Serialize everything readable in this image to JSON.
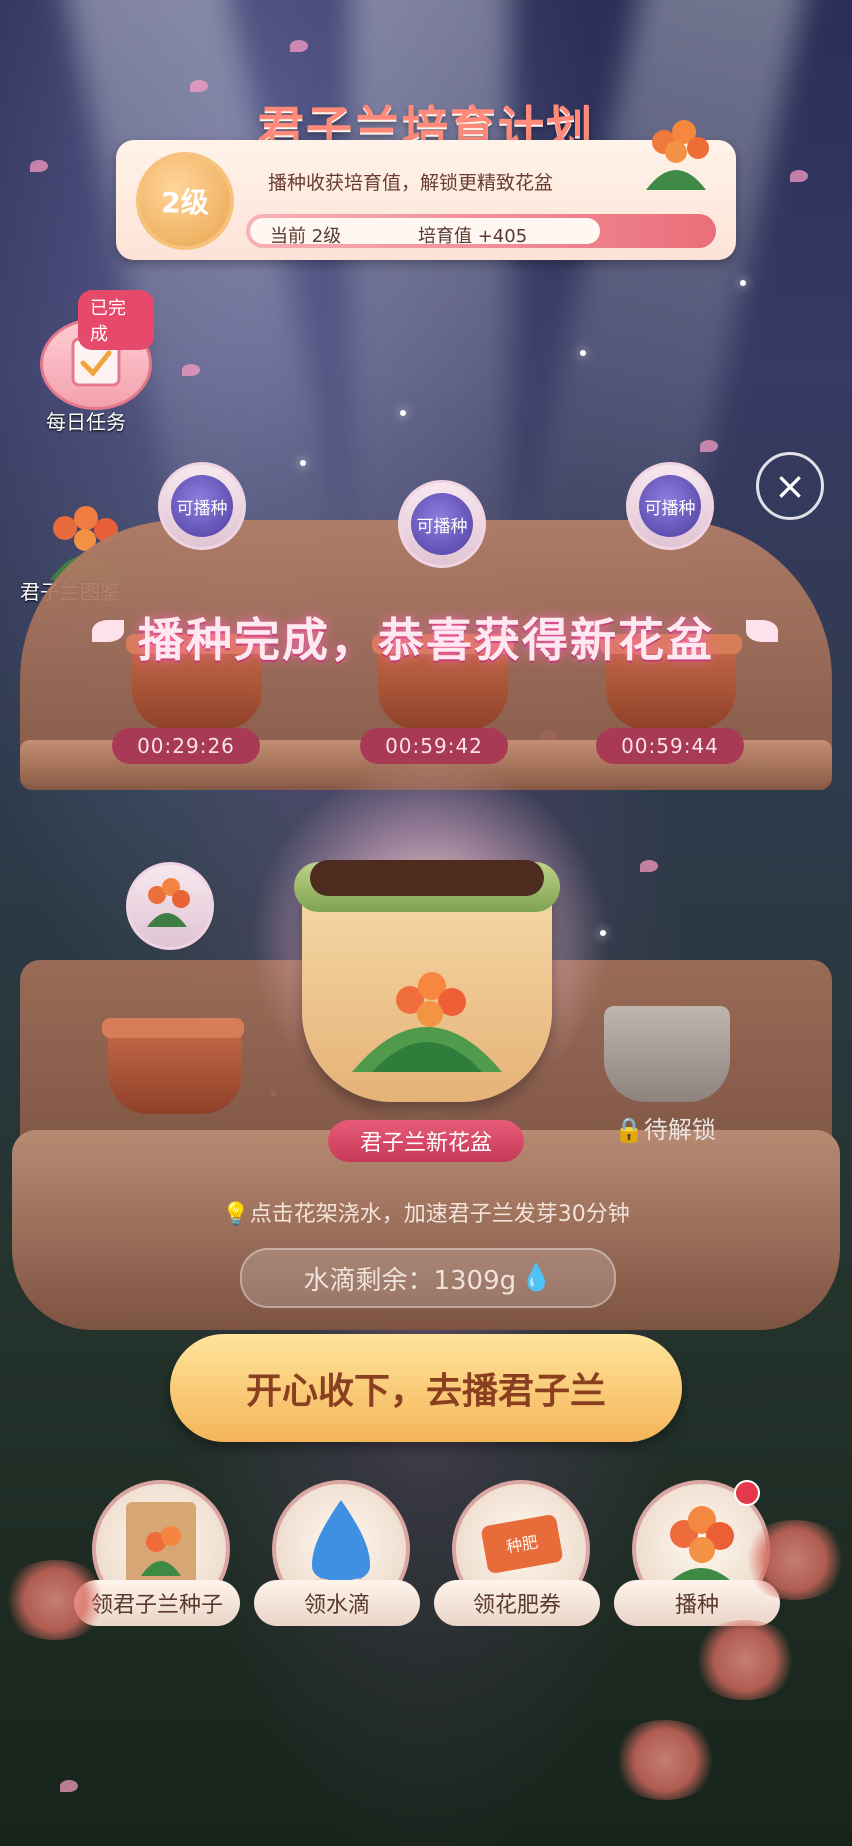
{
  "header": {
    "title": "君子兰培育计划",
    "level": "2级",
    "description": "播种收获培育值，解锁更精致花盆",
    "progress_current": "当前 2级",
    "progress_value": "培育值 +405"
  },
  "side": {
    "daily_badge": "已完成",
    "daily_label": "每日任务",
    "guide_label": "君子兰图鉴"
  },
  "slots": [
    {
      "bubble": "可播种",
      "timer": "00:29:26"
    },
    {
      "bubble": "可播种",
      "timer": "00:59:42"
    },
    {
      "bubble": "可播种",
      "timer": "00:59:44"
    }
  ],
  "banner": "播种完成，恭喜获得新花盆",
  "new_pot_label": "君子兰新花盆",
  "locked_label": "待解锁",
  "hint": "点击花架浇水，加速君子兰发芽30分钟",
  "water_remaining": "水滴剩余：1309g",
  "cta": "开心收下，去播君子兰",
  "actions": [
    {
      "label": "领君子兰种子",
      "icon": "seed-pack-icon"
    },
    {
      "label": "领水滴",
      "icon": "water-drop-icon"
    },
    {
      "label": "领花肥券",
      "icon": "fertilizer-coupon-icon"
    },
    {
      "label": "播种",
      "icon": "clivia-flower-icon",
      "dot": true
    }
  ],
  "coupon_text": "种肥",
  "colors": {
    "accent": "#e6496a",
    "cta_gradient_top": "#ffe59b",
    "cta_gradient_bottom": "#f4b45a",
    "timer_bg": "#a83a56"
  }
}
